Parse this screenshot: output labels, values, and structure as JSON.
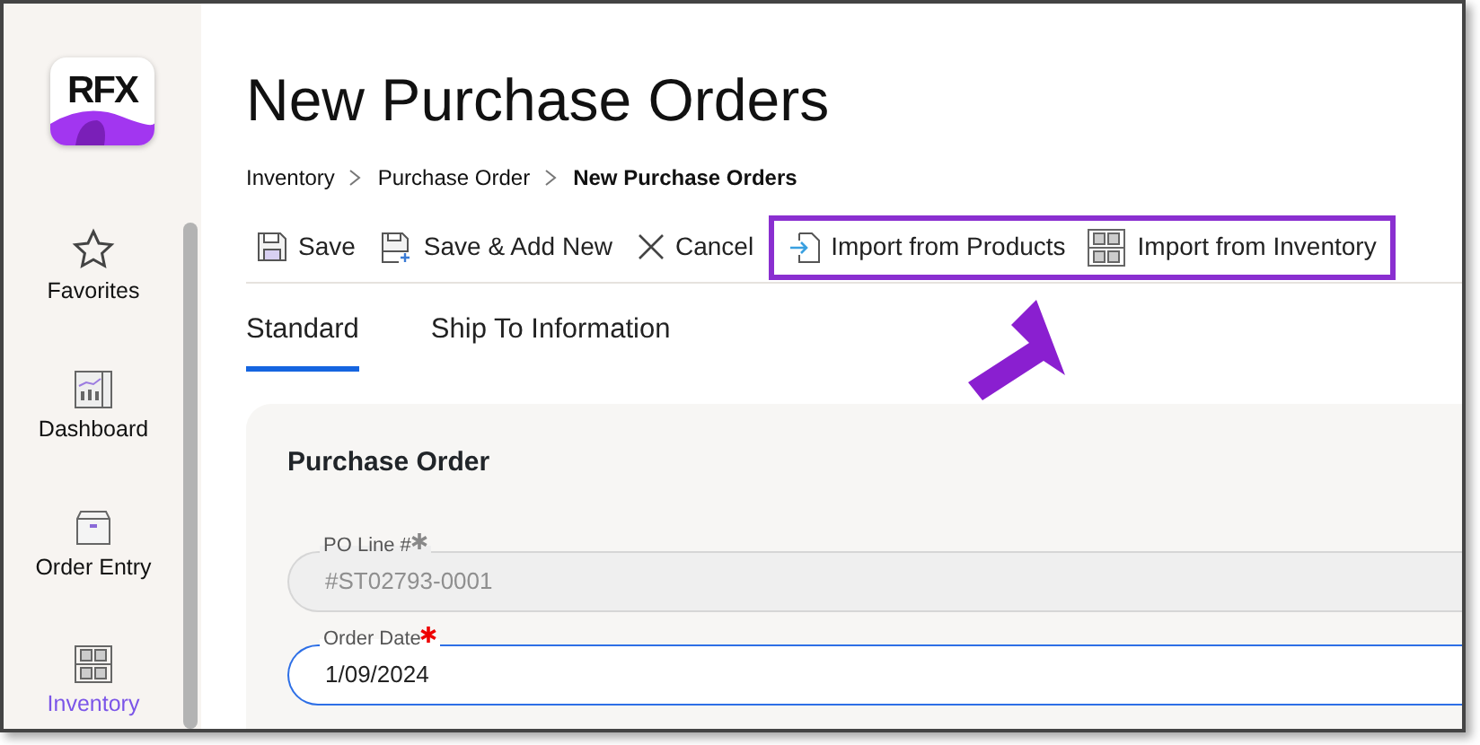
{
  "app": {
    "logo": "RFX"
  },
  "sidebar": {
    "items": [
      {
        "label": "Favorites",
        "kind": "star",
        "selected": false
      },
      {
        "label": "Dashboard",
        "kind": "dashboard",
        "selected": false
      },
      {
        "label": "Order Entry",
        "kind": "box",
        "selected": false
      },
      {
        "label": "Inventory",
        "kind": "shelves",
        "selected": true
      }
    ]
  },
  "page": {
    "title": "New Purchase Orders",
    "breadcrumb": [
      {
        "label": "Inventory",
        "current": false
      },
      {
        "label": "Purchase Order",
        "current": false
      },
      {
        "label": "New Purchase Orders",
        "current": true
      }
    ],
    "toolbar": [
      {
        "label": "Save",
        "kind": "save",
        "highlighted": false
      },
      {
        "label": "Save & Add New",
        "kind": "save-add",
        "highlighted": false
      },
      {
        "label": "Cancel",
        "kind": "cancel",
        "highlighted": false
      },
      {
        "label": "Import from Products",
        "kind": "import",
        "highlighted": true
      },
      {
        "label": "Import from Inventory",
        "kind": "shelves",
        "highlighted": true
      }
    ],
    "tabs": [
      {
        "label": "Standard",
        "selected": true
      },
      {
        "label": "Ship To Information",
        "selected": false
      }
    ],
    "form": {
      "title": "Purchase Order",
      "fields": [
        {
          "label": "PO Line #",
          "value": "#ST02793-0001",
          "required": true,
          "disabled": true,
          "focused": false
        },
        {
          "label": "Order Date",
          "value": "1/09/2024",
          "required": true,
          "disabled": false,
          "focused": true
        }
      ]
    }
  }
}
